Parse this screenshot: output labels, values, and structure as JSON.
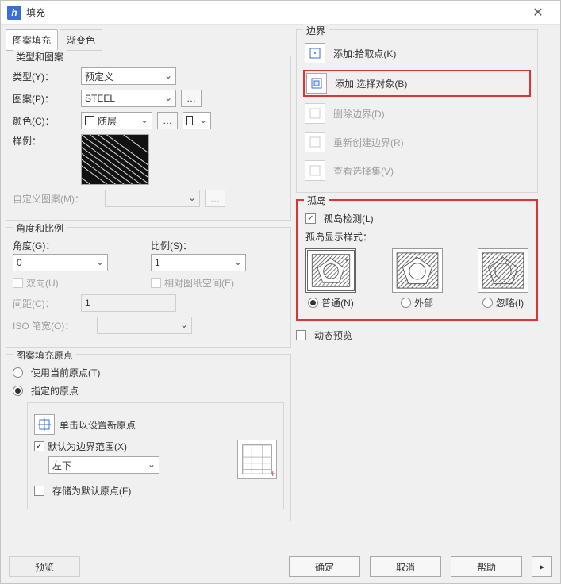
{
  "title": "填充",
  "tabs": {
    "pattern": "图案填充",
    "gradient": "渐变色"
  },
  "typePattern": {
    "legend": "类型和图案",
    "type_lbl": "类型(Y)：",
    "type_val": "预定义",
    "pattern_lbl": "图案(P)：",
    "pattern_val": "STEEL",
    "color_lbl": "颜色(C)：",
    "color_val": "随层",
    "sample_lbl": "样例：",
    "custom_lbl": "自定义图案(M)："
  },
  "angleScale": {
    "legend": "角度和比例",
    "angle_lbl": "角度(G)：",
    "angle_val": "0",
    "scale_lbl": "比例(S)：",
    "scale_val": "1",
    "bidir": "双向(U)",
    "paperspace": "相对图纸空间(E)",
    "spacing_lbl": "间距(C)：",
    "spacing_val": "1",
    "iso_lbl": "ISO 笔宽(O)："
  },
  "origin": {
    "legend": "图案填充原点",
    "use_current": "使用当前原点(T)",
    "specified": "指定的原点",
    "click_new": "单击以设置新原点",
    "default_extent": "默认为边界范围(X)",
    "pos_val": "左下",
    "store_default": "存储为默认原点(F)"
  },
  "boundary": {
    "legend": "边界",
    "add_pick": "添加:拾取点(K)",
    "add_select": "添加:选择对象(B)",
    "del": "删除边界(D)",
    "recreate": "重新创建边界(R)",
    "view_sel": "查看选择集(V)"
  },
  "island": {
    "legend": "孤岛",
    "detect": "孤岛检测(L)",
    "style_lbl": "孤岛显示样式：",
    "normal": "普通(N)",
    "outer": "外部",
    "ignore": "忽略(I)"
  },
  "dyn_preview": "动态预览",
  "footer": {
    "preview": "预览",
    "ok": "确定",
    "cancel": "取消",
    "help": "帮助"
  }
}
